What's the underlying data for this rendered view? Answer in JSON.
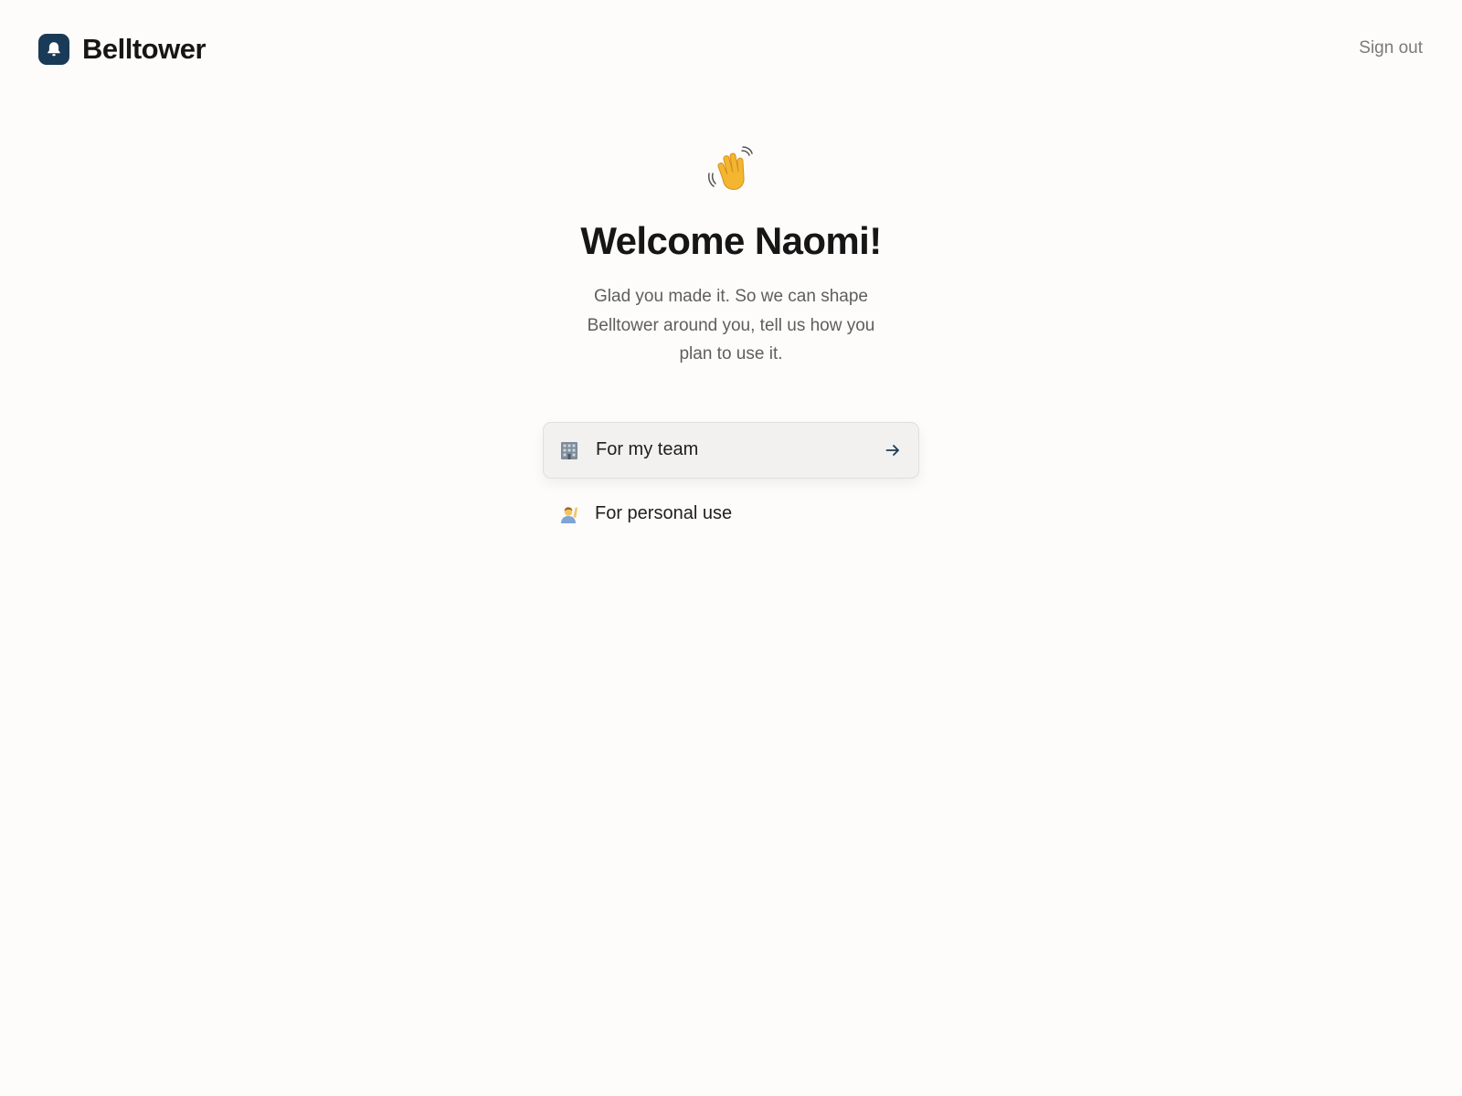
{
  "header": {
    "brand_name": "Belltower",
    "sign_out_label": "Sign out"
  },
  "welcome": {
    "emoji_icon": "waving-hand-icon",
    "title": "Welcome Naomi!",
    "subtitle": "Glad you made it. So we can shape Belltower around you, tell us how you plan to use it."
  },
  "options": [
    {
      "icon": "office-building-icon",
      "label": "For my team",
      "selected": true
    },
    {
      "icon": "person-raising-hand-icon",
      "label": "For personal use",
      "selected": false
    }
  ],
  "colors": {
    "brand": "#193b57",
    "background": "#fdfcfb",
    "selected_option_bg": "#f2f1f0"
  }
}
